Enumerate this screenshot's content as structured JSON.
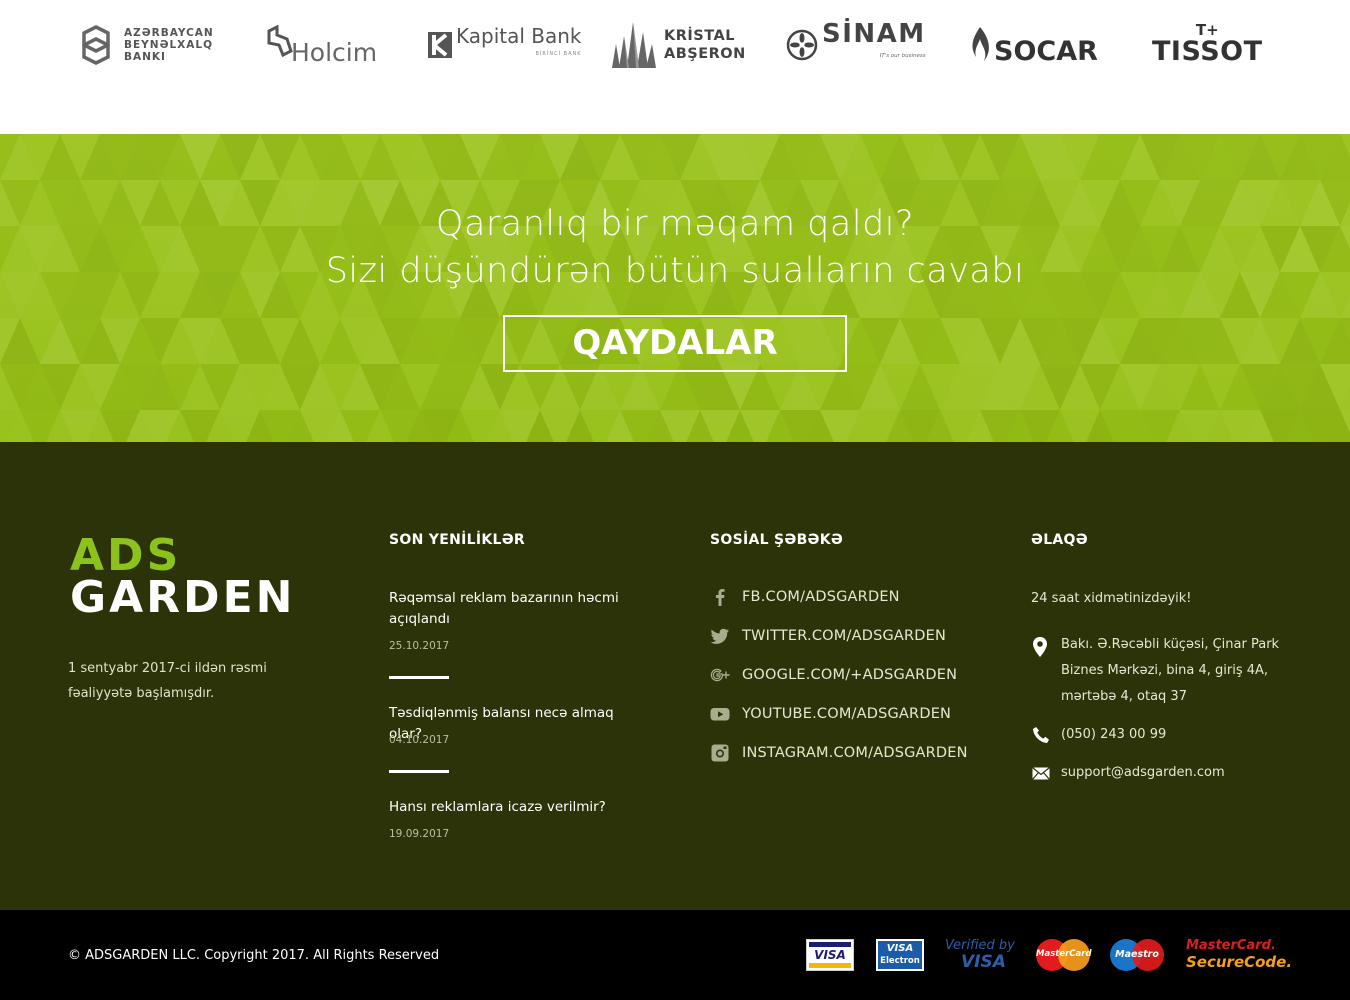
{
  "partners": [
    {
      "name": "azerbaycan-beynelxalq-banki",
      "lines": [
        "AZƏRBAYCAN",
        "BEYNƏLXALQ",
        "BANKI"
      ]
    },
    {
      "name": "holcim",
      "label": "Holcim"
    },
    {
      "name": "kapital-bank",
      "label": "Kapital Bank",
      "sub": "BİRİNCİ BANK"
    },
    {
      "name": "kristal-abseron",
      "lines": [
        "KRİSTAL",
        "ABŞERON"
      ]
    },
    {
      "name": "sinam",
      "label": "SİNAM",
      "sub": "IT's our business"
    },
    {
      "name": "socar",
      "label": "SOCAR"
    },
    {
      "name": "tissot",
      "label": "TISSOT",
      "top": "T+"
    }
  ],
  "cta": {
    "line1": "Qaranlıq bir məqam qaldı?",
    "line2": "Sizi düşündürən bütün sualların cavabı",
    "button": "QAYDALAR"
  },
  "footer": {
    "brand_top": "ADS",
    "brand_bottom": "GARDEN",
    "description": "1 sentyabr 2017-ci ildən rəsmi fəaliyyətə başlamışdır.",
    "news_title": "SON YENİLİKLƏR",
    "news": [
      {
        "title": "Rəqəmsal reklam bazarının həcmi açıqlandı",
        "date": "25.10.2017"
      },
      {
        "title": "Təsdiqlənmiş balansı necə almaq olar?",
        "date": "04.10.2017"
      },
      {
        "title": "Hansı reklamlara icazə verilmir?",
        "date": "19.09.2017"
      }
    ],
    "social_title": "SOSİAL ŞƏBƏKƏ",
    "social": [
      {
        "icon": "facebook-icon",
        "label": "FB.COM/ADSGARDEN"
      },
      {
        "icon": "twitter-icon",
        "label": "TWITTER.COM/ADSGARDEN"
      },
      {
        "icon": "google-plus-icon",
        "label": "GOOGLE.COM/+ADSGARDEN"
      },
      {
        "icon": "youtube-icon",
        "label": "YOUTUBE.COM/ADSGARDEN"
      },
      {
        "icon": "instagram-icon",
        "label": "INSTAGRAM.COM/ADSGARDEN"
      }
    ],
    "contact_title": "ƏLAQƏ",
    "contact": {
      "service": "24 saat xidmətinizdəyik!",
      "address_lines": [
        "Bakı. Ə.Rəcəbli küçəsi, Çinar Park",
        "Biznes Mərkəzi, bina 4, giriş 4A,",
        "mərtəbə 4, otaq 37"
      ],
      "phone": "(050) 243 00 99",
      "email": "support@adsgarden.com"
    }
  },
  "bottom": {
    "copyright": "© ADSGARDEN LLC. Copyright 2017. All Rights Reserved",
    "payments": {
      "visa": "VISA",
      "visa_electron_top": "VISA",
      "visa_electron_bottom": "Electron",
      "verified_top": "Verified by",
      "verified_bottom": "VISA",
      "mastercard": "MasterCard",
      "maestro": "Maestro",
      "securecode_top": "MasterCard.",
      "securecode_bottom": "SecureCode."
    }
  },
  "colors": {
    "cta_green": "#9bc31c",
    "footer_bg": "#2d3309",
    "brand_green": "#8cc21c",
    "bottom_bg": "#000000"
  }
}
